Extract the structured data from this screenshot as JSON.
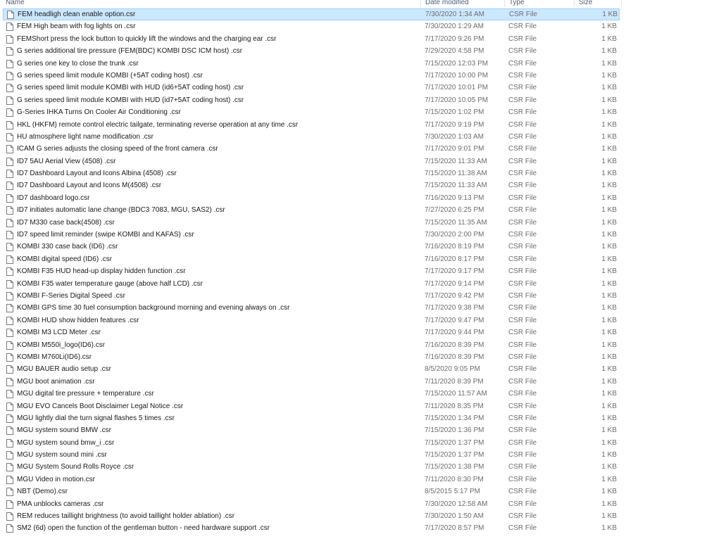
{
  "columns": {
    "name": "Name",
    "date_modified": "Date modified",
    "type": "Type",
    "size": "Size"
  },
  "files": [
    {
      "name": "FEM headligh clean enable option.csr",
      "date": "7/30/2020 1:34 AM",
      "type": "CSR File",
      "size": "1 KB",
      "selected": true
    },
    {
      "name": "FEM High beam with fog lights on .csr",
      "date": "7/30/2020 1:29 AM",
      "type": "CSR File",
      "size": "1 KB"
    },
    {
      "name": "FEMShort press the lock button to quickly lift the windows and the charging ear .csr",
      "date": "7/17/2020 9:26 PM",
      "type": "CSR File",
      "size": "1 KB"
    },
    {
      "name": "G series additional tire pressure (FEM(BDC) KOMBI DSC ICM host) .csr",
      "date": "7/29/2020 4:58 PM",
      "type": "CSR File",
      "size": "1 KB"
    },
    {
      "name": "G series one key to close the trunk .csr",
      "date": "7/15/2020 12:03 PM",
      "type": "CSR File",
      "size": "1 KB"
    },
    {
      "name": "G series speed limit module KOMBI (+5AT coding host) .csr",
      "date": "7/17/2020 10:00 PM",
      "type": "CSR File",
      "size": "1 KB"
    },
    {
      "name": "G series speed limit module KOMBI with HUD (id6+5AT coding host) .csr",
      "date": "7/17/2020 10:01 PM",
      "type": "CSR File",
      "size": "1 KB"
    },
    {
      "name": "G series speed limit module KOMBI with HUD (id7+5AT coding host) .csr",
      "date": "7/17/2020 10:05 PM",
      "type": "CSR File",
      "size": "1 KB"
    },
    {
      "name": "G-Series IHKA Turns On Cooler Air Conditioning .csr",
      "date": "7/15/2020 1:02 PM",
      "type": "CSR File",
      "size": "1 KB"
    },
    {
      "name": "HKL (HKFM) remote control electric tailgate, terminating reverse operation at any time .csr",
      "date": "7/17/2020 9:19 PM",
      "type": "CSR File",
      "size": "1 KB"
    },
    {
      "name": "HU atmosphere light name modification .csr",
      "date": "7/30/2020 1:03 AM",
      "type": "CSR File",
      "size": "1 KB"
    },
    {
      "name": "ICAM G series adjusts the closing speed of the front camera .csr",
      "date": "7/17/2020 9:01 PM",
      "type": "CSR File",
      "size": "1 KB"
    },
    {
      "name": "ID7 5AU Aerial View (4508) .csr",
      "date": "7/15/2020 11:33 AM",
      "type": "CSR File",
      "size": "1 KB"
    },
    {
      "name": "ID7 Dashboard Layout and Icons Albina (4508) .csr",
      "date": "7/15/2020 11:38 AM",
      "type": "CSR File",
      "size": "1 KB"
    },
    {
      "name": "ID7 Dashboard Layout and Icons M(4508) .csr",
      "date": "7/15/2020 11:33 AM",
      "type": "CSR File",
      "size": "1 KB"
    },
    {
      "name": "ID7 dashboard logo.csr",
      "date": "7/16/2020 9:13 PM",
      "type": "CSR File",
      "size": "1 KB"
    },
    {
      "name": "ID7 initiates automatic lane change (BDC3 7083, MGU, SAS2) .csr",
      "date": "7/27/2020 6:25 PM",
      "type": "CSR File",
      "size": "1 KB"
    },
    {
      "name": "ID7 M330 case back(4508) .csr",
      "date": "7/15/2020 11:35 AM",
      "type": "CSR File",
      "size": "1 KB"
    },
    {
      "name": "ID7 speed limit reminder (swipe KOMBI and KAFAS) .csr",
      "date": "7/30/2020 2:00 PM",
      "type": "CSR File",
      "size": "1 KB"
    },
    {
      "name": "KOMBI 330 case back (ID6) .csr",
      "date": "7/16/2020 8:19 PM",
      "type": "CSR File",
      "size": "1 KB"
    },
    {
      "name": "KOMBI digital speed (ID6) .csr",
      "date": "7/16/2020 8:17 PM",
      "type": "CSR File",
      "size": "1 KB"
    },
    {
      "name": "KOMBI F35 HUD head-up display hidden function .csr",
      "date": "7/17/2020 9:17 PM",
      "type": "CSR File",
      "size": "1 KB"
    },
    {
      "name": "KOMBI F35 water temperature gauge (above half LCD) .csr",
      "date": "7/17/2020 9:14 PM",
      "type": "CSR File",
      "size": "1 KB"
    },
    {
      "name": "KOMBI F-Series Digital Speed .csr",
      "date": "7/17/2020 9:42 PM",
      "type": "CSR File",
      "size": "1 KB"
    },
    {
      "name": "KOMBI GPS time 30 fuel consumption background morning and evening always on .csr",
      "date": "7/17/2020 9:38 PM",
      "type": "CSR File",
      "size": "1 KB"
    },
    {
      "name": "KOMBI HUD show hidden features .csr",
      "date": "7/17/2020 9:47 PM",
      "type": "CSR File",
      "size": "1 KB"
    },
    {
      "name": "KOMBI M3 LCD Meter .csr",
      "date": "7/17/2020 9:44 PM",
      "type": "CSR File",
      "size": "1 KB"
    },
    {
      "name": "KOMBI M550i_logo(ID6).csr",
      "date": "7/16/2020 8:39 PM",
      "type": "CSR File",
      "size": "1 KB"
    },
    {
      "name": "KOMBI M760Li(ID6).csr",
      "date": "7/16/2020 8:39 PM",
      "type": "CSR File",
      "size": "1 KB"
    },
    {
      "name": "MGU BAUER audio setup .csr",
      "date": "8/5/2020 9:05 PM",
      "type": "CSR File",
      "size": "1 KB"
    },
    {
      "name": "MGU boot animation .csr",
      "date": "7/11/2020 8:39 PM",
      "type": "CSR File",
      "size": "1 KB"
    },
    {
      "name": "MGU digital tire pressure + temperature .csr",
      "date": "7/15/2020 11:57 AM",
      "type": "CSR File",
      "size": "1 KB"
    },
    {
      "name": "MGU EVO Cancels Boot Disclaimer Legal Notice .csr",
      "date": "7/11/2020 8:35 PM",
      "type": "CSR File",
      "size": "1 KB"
    },
    {
      "name": "MGU lightly dial the turn signal flashes 5 times .csr",
      "date": "7/15/2020 1:34 PM",
      "type": "CSR File",
      "size": "1 KB"
    },
    {
      "name": "MGU system sound BMW .csr",
      "date": "7/15/2020 1:36 PM",
      "type": "CSR File",
      "size": "1 KB"
    },
    {
      "name": "MGU system sound bmw_i .csr",
      "date": "7/15/2020 1:37 PM",
      "type": "CSR File",
      "size": "1 KB"
    },
    {
      "name": "MGU system sound mini .csr",
      "date": "7/15/2020 1:37 PM",
      "type": "CSR File",
      "size": "1 KB"
    },
    {
      "name": "MGU System Sound Rolls Royce .csr",
      "date": "7/15/2020 1:38 PM",
      "type": "CSR File",
      "size": "1 KB"
    },
    {
      "name": "MGU Video in motion.csr",
      "date": "7/11/2020 8:30 PM",
      "type": "CSR File",
      "size": "1 KB"
    },
    {
      "name": "NBT (Demo).csr",
      "date": "8/5/2015 5:17 PM",
      "type": "CSR File",
      "size": "1 KB"
    },
    {
      "name": "PMA unblocks cameras .csr",
      "date": "7/30/2020 12:58 AM",
      "type": "CSR File",
      "size": "1 KB"
    },
    {
      "name": "REM reduces taillight brightness (to avoid taillight holder ablation) .csr",
      "date": "7/30/2020 1:50 AM",
      "type": "CSR File",
      "size": "1 KB"
    },
    {
      "name": "SM2 (6d) open the function of the gentleman button - need hardware support .csr",
      "date": "7/17/2020 8:57 PM",
      "type": "CSR File",
      "size": "1 KB"
    }
  ]
}
